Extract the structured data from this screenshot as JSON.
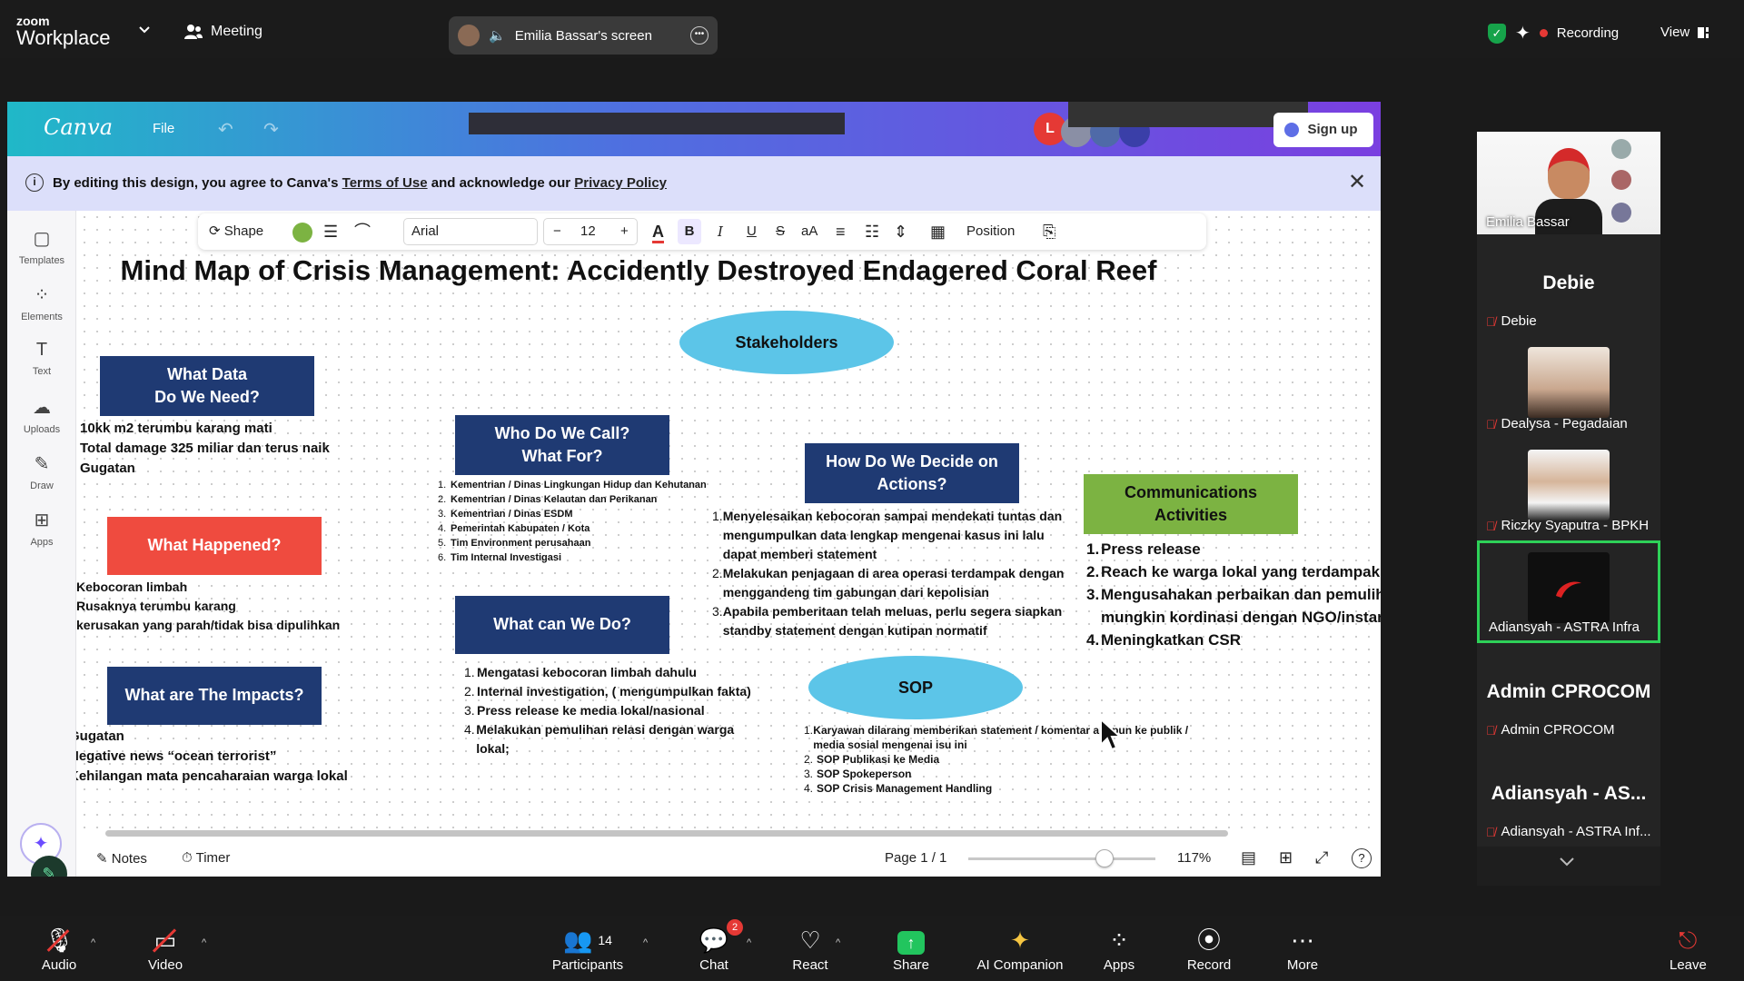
{
  "zoom": {
    "brand_top": "zoom",
    "brand_bottom": "Workplace",
    "meeting_label": "Meeting",
    "share_label": "Emilia Bassar's screen",
    "recording_label": "Recording",
    "view_label": "View"
  },
  "canva": {
    "logo": "Canva",
    "file_menu": "File",
    "avatar_initial": "L",
    "signup": "Sign up",
    "notice": {
      "prefix": "By editing this design, you agree to Canva's",
      "terms": "Terms of Use",
      "middle": "and acknowledge our",
      "privacy": "Privacy Policy"
    },
    "sidebar": [
      {
        "label": "Templates",
        "icon": "templates-icon"
      },
      {
        "label": "Elements",
        "icon": "elements-icon"
      },
      {
        "label": "Text",
        "icon": "text-icon"
      },
      {
        "label": "Uploads",
        "icon": "uploads-icon"
      },
      {
        "label": "Draw",
        "icon": "draw-icon"
      },
      {
        "label": "Apps",
        "icon": "apps-icon"
      }
    ],
    "toolbar": {
      "shape": "Shape",
      "font": "Arial",
      "minus": "−",
      "size": "12",
      "plus": "+",
      "case": "aA",
      "position": "Position",
      "fill_color": "#7cb342"
    },
    "footer": {
      "notes": "Notes",
      "timer": "Timer",
      "page": "Page 1 / 1",
      "zoom": "117%"
    }
  },
  "mindmap": {
    "title": "Mind Map of Crisis Management: Accidently Destroyed Endagered Coral Reef",
    "stakeholders": "Stakeholders",
    "what_data": {
      "heading_l1": "What Data",
      "heading_l2": "Do We Need?",
      "items": [
        "10kk m2  terumbu karang mati",
        "Total damage 325 miliar dan terus naik",
        "Gugatan"
      ]
    },
    "what_happened": {
      "heading": "What Happened?",
      "items": [
        "Kebocoran limbah",
        "Rusaknya terumbu karang",
        "kerusakan yang parah/tidak bisa dipulihkan"
      ]
    },
    "impacts": {
      "heading": "What are The Impacts?",
      "items": [
        "Gugatan",
        "Negative news “ocean terrorist”",
        "Kehilangan mata pencaharaian warga lokal"
      ]
    },
    "who_call": {
      "heading_l1": "Who Do We Call?",
      "heading_l2": "What For?",
      "items": [
        "Kementrian / Dinas Lingkungan Hidup dan Kehutanan",
        "Kementrian / Dinas Kelautan dan Perikanan",
        "Kementrian / Dinas ESDM",
        "Pemerintah Kabupaten / Kota",
        "Tim Environment perusahaan",
        "Tim Internal Investigasi"
      ]
    },
    "what_do": {
      "heading": "What can We Do?",
      "items": [
        "Mengatasi kebocoran limbah dahulu",
        "Internal investigation, ( mengumpulkan fakta)",
        "Press release ke media lokal/nasional",
        "Melakukan pemulihan relasi dengan warga lokal;"
      ]
    },
    "decide": {
      "heading_l1": "How Do We Decide on",
      "heading_l2": "Actions?",
      "items": [
        "Menyelesaikan kebocoran sampai mendekati tuntas dan mengumpulkan data lengkap mengenai kasus ini lalu dapat memberi statement",
        "Melakukan penjagaan di area operasi terdampak dengan menggandeng tim gabungan dari kepolisian",
        "Apabila pemberitaan telah meluas, perlu segera siapkan standby statement dengan kutipan normatif"
      ]
    },
    "sop": {
      "heading": "SOP",
      "items": [
        "Karyawan dilarang memberikan statement / komentar apapun ke publik / media sosial mengenai isu ini",
        "SOP Publikasi ke Media",
        "SOP Spokeperson",
        "SOP Crisis Management Handling"
      ]
    },
    "comms": {
      "heading_l1": "Communications",
      "heading_l2": "Activities",
      "items": [
        "Press release",
        "Reach ke warga lokal yang terdampak",
        "Mengusahakan perbaikan dan pemulihan",
        "mungkin kordinasi dengan NGO/instansi",
        "Meningkatkan CSR"
      ]
    },
    "colors": {
      "navy": "#1f3a73",
      "red": "#ef4b3f",
      "green": "#7cb342",
      "ellipse": "#5cc5e8"
    }
  },
  "participants": [
    {
      "name": "Emilia Bassar",
      "type": "video"
    },
    {
      "name": "Debie",
      "big": "Debie"
    },
    {
      "name": "Dealysa - Pegadaian",
      "type": "photo"
    },
    {
      "name": "Riczky Syaputra - BPKH",
      "type": "photo"
    },
    {
      "name": "Adiansyah - ASTRA Infra",
      "type": "photo",
      "active": true
    },
    {
      "name": "Admin CPROCOM",
      "big": "Admin CPROCOM"
    },
    {
      "name": "Adiansyah - ASTRA Inf...",
      "big": "Adiansyah  -  AS..."
    }
  ],
  "bottombar": {
    "audio": "Audio",
    "video": "Video",
    "participants": "Participants",
    "participants_count": "14",
    "chat": "Chat",
    "chat_badge": "2",
    "react": "React",
    "share": "Share",
    "ai": "AI Companion",
    "apps": "Apps",
    "record": "Record",
    "more": "More",
    "leave": "Leave"
  }
}
